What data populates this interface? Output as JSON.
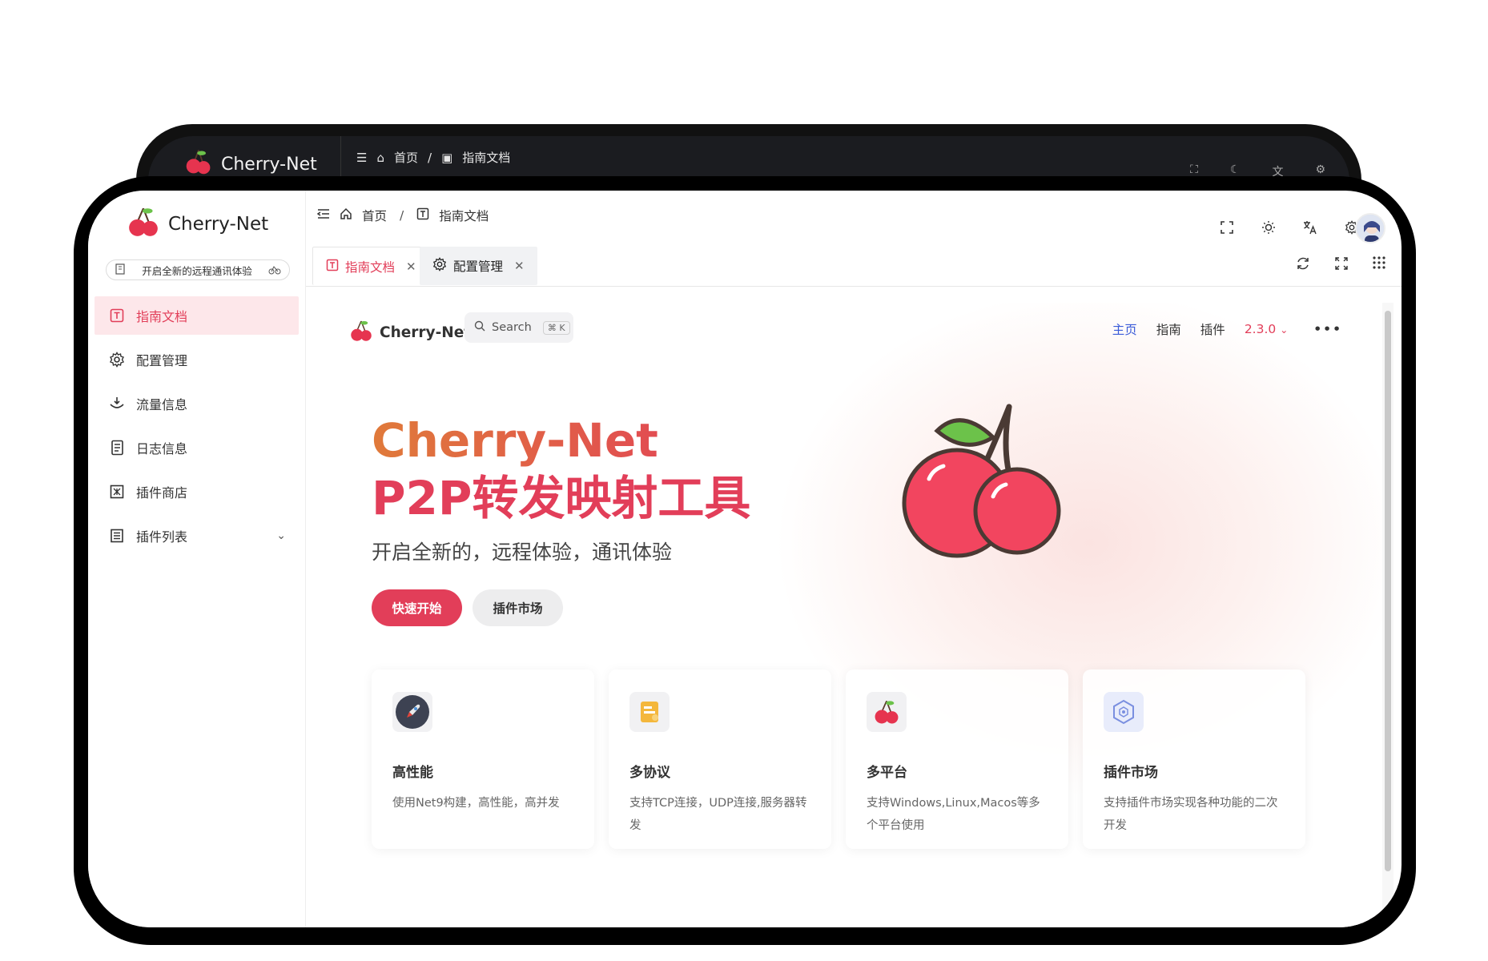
{
  "app": {
    "name": "Cherry-Net",
    "tagline": "开启全新的远程通讯体验"
  },
  "back_window": {
    "brand": "Cherry-Net",
    "breadcrumb_home": "首页",
    "breadcrumb_sep": "/",
    "breadcrumb_current": "指南文档"
  },
  "sidebar": {
    "items": [
      {
        "label": "指南文档",
        "icon": "doc-text-icon",
        "active": true
      },
      {
        "label": "配置管理",
        "icon": "gear-icon"
      },
      {
        "label": "流量信息",
        "icon": "traffic-icon"
      },
      {
        "label": "日志信息",
        "icon": "log-icon"
      },
      {
        "label": "插件商店",
        "icon": "store-icon"
      },
      {
        "label": "插件列表",
        "icon": "list-icon",
        "has_children": true
      }
    ]
  },
  "header": {
    "breadcrumb_home": "首页",
    "breadcrumb_sep": "/",
    "breadcrumb_current": "指南文档"
  },
  "tabs": [
    {
      "label": "指南文档",
      "active": true
    },
    {
      "label": "配置管理"
    }
  ],
  "docs": {
    "brand": "Cherry-Net",
    "search_placeholder": "Search",
    "search_shortcut": "⌘ K",
    "nav": {
      "home": "主页",
      "guide": "指南",
      "plugins": "插件",
      "version": "2.3.0",
      "more": "•••"
    },
    "hero": {
      "title_line1": "Cherry-Net",
      "title_line2": "P2P转发映射工具",
      "subtitle": "开启全新的，远程体验，通讯体验",
      "primary_button": "快速开始",
      "secondary_button": "插件市场"
    },
    "features": [
      {
        "title": "高性能",
        "desc": "使用Net9构建，高性能，高并发",
        "icon": "rocket-icon"
      },
      {
        "title": "多协议",
        "desc": "支持TCP连接，UDP连接,服务器转发",
        "icon": "folder-icon"
      },
      {
        "title": "多平台",
        "desc": "支持Windows,Linux,Macos等多个平台使用",
        "icon": "cherry-icon"
      },
      {
        "title": "插件市场",
        "desc": "支持插件市场实现各种功能的二次开发",
        "icon": "plugin-icon"
      }
    ]
  },
  "colors": {
    "accent": "#e23e59",
    "link": "#3a5bd8",
    "active_bg": "#fde7ea"
  }
}
